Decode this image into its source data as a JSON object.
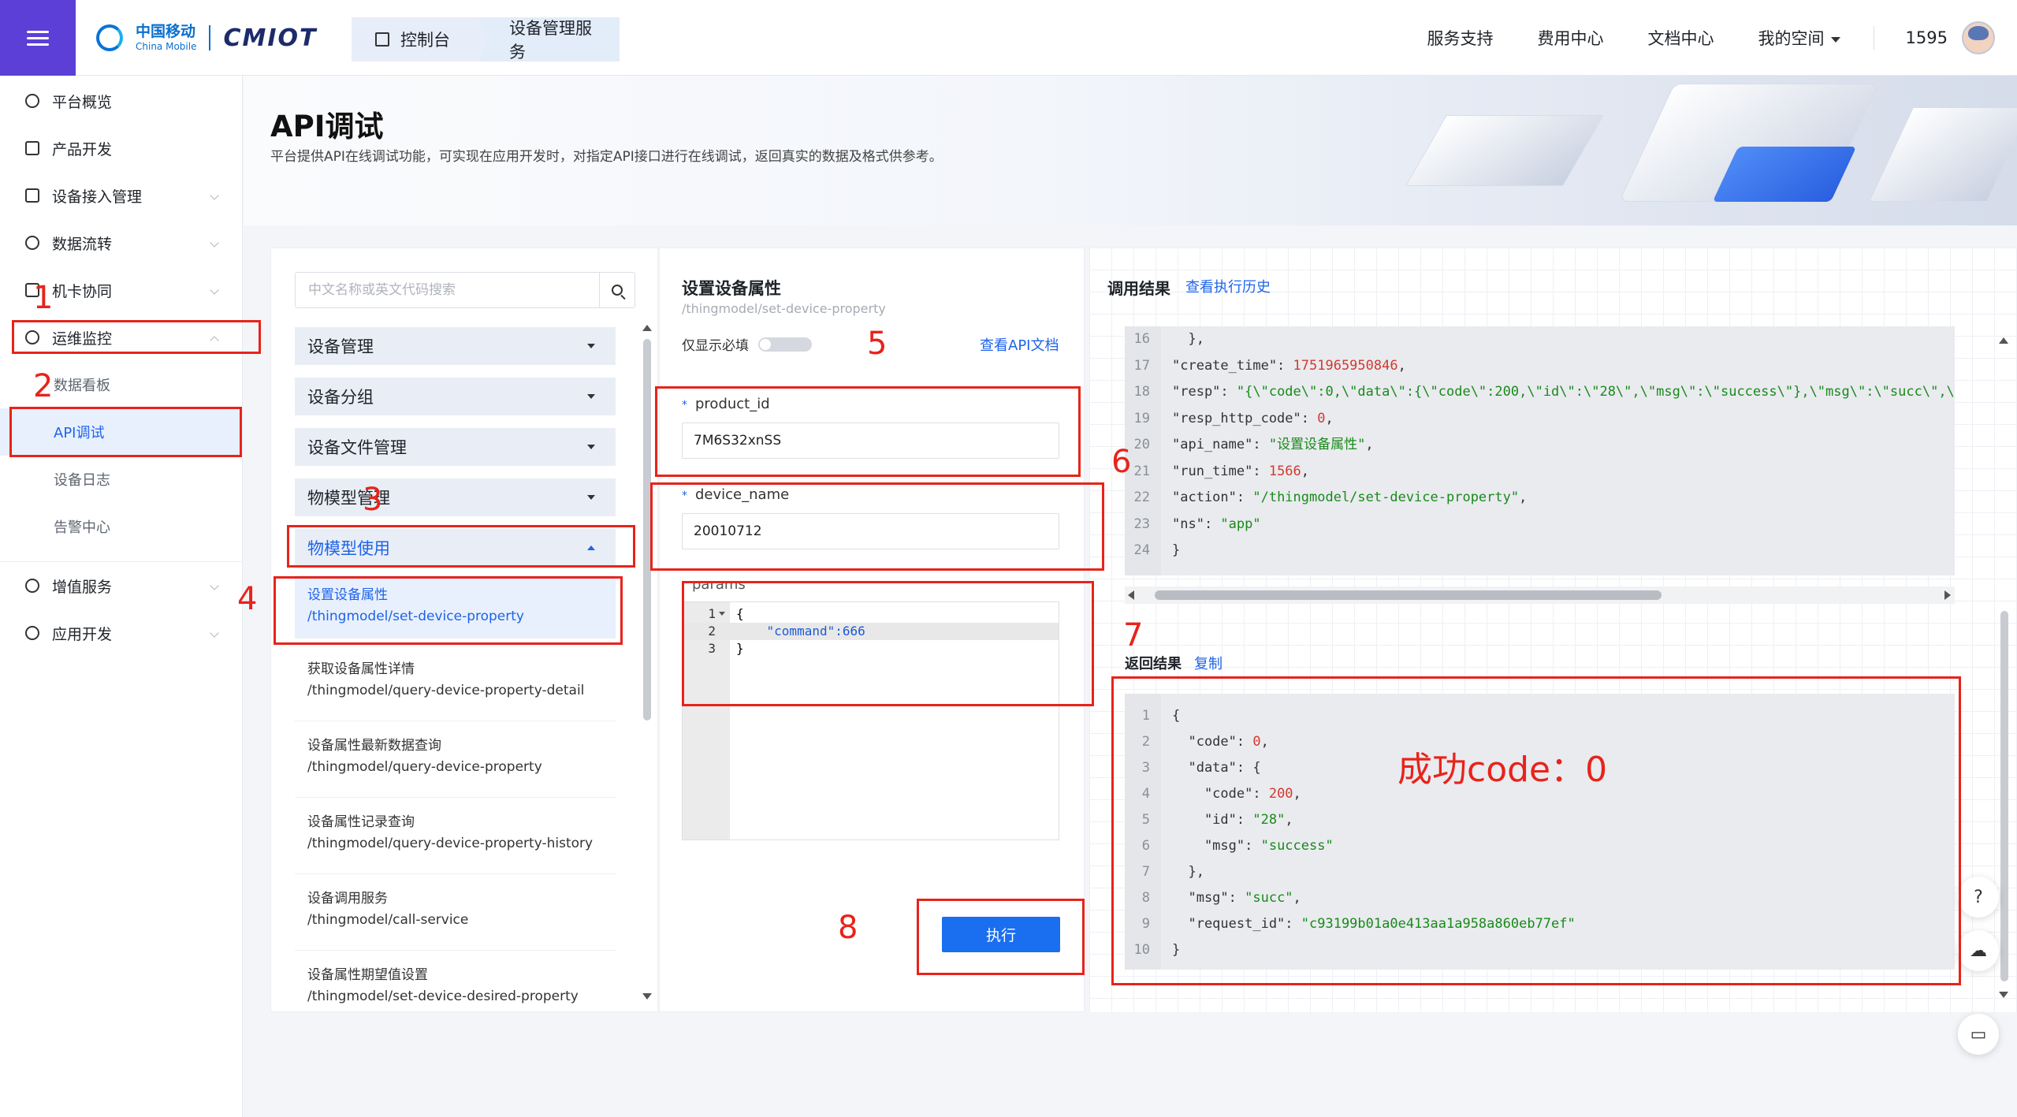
{
  "header": {
    "logo_cn": "中国移动",
    "logo_en": "China Mobile",
    "logo_brand": "CMIOT",
    "breadcrumb": [
      "控制台",
      "设备管理服务"
    ],
    "nav": [
      "服务支持",
      "费用中心",
      "文档中心",
      "我的空间"
    ],
    "user_id": "1595"
  },
  "sidebar": {
    "items": [
      {
        "label": "平台概览"
      },
      {
        "label": "产品开发"
      },
      {
        "label": "设备接入管理"
      },
      {
        "label": "数据流转"
      },
      {
        "label": "机卡协同"
      },
      {
        "label": "运维监控"
      },
      {
        "label": "增值服务"
      },
      {
        "label": "应用开发"
      }
    ],
    "sub_items": [
      "数据看板",
      "API调试",
      "设备日志",
      "告警中心"
    ]
  },
  "page": {
    "title": "API调试",
    "description": "平台提供API在线调试功能，可实现在应用开发时，对指定API接口进行在线调试，返回真实的数据及格式供参考。"
  },
  "left_panel": {
    "search_placeholder": "中文名称或英文代码搜索",
    "groups": [
      "设备管理",
      "设备分组",
      "设备文件管理",
      "物模型管理",
      "物模型使用"
    ],
    "apis": [
      {
        "name": "设置设备属性",
        "path": "/thingmodel/set-device-property"
      },
      {
        "name": "获取设备属性详情",
        "path": "/thingmodel/query-device-property-detail"
      },
      {
        "name": "设备属性最新数据查询",
        "path": "/thingmodel/query-device-property"
      },
      {
        "name": "设备属性记录查询",
        "path": "/thingmodel/query-device-property-history"
      },
      {
        "name": "设备调用服务",
        "path": "/thingmodel/call-service"
      },
      {
        "name": "设备属性期望值设置",
        "path": "/thingmodel/set-device-desired-property"
      }
    ]
  },
  "middle_panel": {
    "title": "设置设备属性",
    "path": "/thingmodel/set-device-property",
    "required_only_label": "仅显示必填",
    "required_only_on": false,
    "api_doc_link": "查看API文档",
    "fields": [
      {
        "label": "product_id",
        "value": "7M6S32xnSS"
      },
      {
        "label": "device_name",
        "value": "20010712"
      }
    ],
    "params_label": "params",
    "params_lines": [
      {
        "num": "1",
        "text": "{"
      },
      {
        "num": "2",
        "text": "    \"command\":666"
      },
      {
        "num": "3",
        "text": "}"
      }
    ],
    "run_button": "执行"
  },
  "right_panel": {
    "title": "调用结果",
    "history_link": "查看执行历史",
    "call_result_lines": [
      {
        "num": "16",
        "text": "  },"
      },
      {
        "num": "17",
        "key": "\"create_time\"",
        "value": "1751965950846",
        "vtype": "n",
        "tail": ","
      },
      {
        "num": "18",
        "key": "\"resp\"",
        "value": "\"{\\\"code\\\":0,\\\"data\\\":{\\\"code\\\":200,\\\"id\\\":\\\"28\\\",\\\"msg\\\":\\\"success\\\"},\\\"msg\\\":\\\"succ\\\",\\\"",
        "vtype": "s",
        "tail": ""
      },
      {
        "num": "19",
        "key": "\"resp_http_code\"",
        "value": "0",
        "vtype": "n",
        "tail": ","
      },
      {
        "num": "20",
        "key": "\"api_name\"",
        "value": "\"设置设备属性\"",
        "vtype": "s",
        "tail": ","
      },
      {
        "num": "21",
        "key": "\"run_time\"",
        "value": "1566",
        "vtype": "n",
        "tail": ","
      },
      {
        "num": "22",
        "key": "\"action\"",
        "value": "\"/thingmodel/set-device-property\"",
        "vtype": "s",
        "tail": ","
      },
      {
        "num": "23",
        "key": "\"ns\"",
        "value": "\"app\"",
        "vtype": "s",
        "tail": ""
      },
      {
        "num": "24",
        "text": "}"
      }
    ],
    "return_title": "返回结果",
    "copy_link": "复制",
    "return_lines": [
      {
        "num": "1",
        "text": "{"
      },
      {
        "num": "2",
        "key": "  \"code\"",
        "value": "0",
        "vtype": "n",
        "tail": ","
      },
      {
        "num": "3",
        "key": "  \"data\"",
        "value": "",
        "vtype": "k",
        "tail": "{"
      },
      {
        "num": "4",
        "key": "    \"code\"",
        "value": "200",
        "vtype": "n",
        "tail": ","
      },
      {
        "num": "5",
        "key": "    \"id\"",
        "value": "\"28\"",
        "vtype": "s",
        "tail": ","
      },
      {
        "num": "6",
        "key": "    \"msg\"",
        "value": "\"success\"",
        "vtype": "s",
        "tail": ""
      },
      {
        "num": "7",
        "text": "  },"
      },
      {
        "num": "8",
        "key": "  \"msg\"",
        "value": "\"succ\"",
        "vtype": "s",
        "tail": ","
      },
      {
        "num": "9",
        "key": "  \"request_id\"",
        "value": "\"c93199b01a0e413aa1a958a860eb77ef\"",
        "vtype": "s",
        "tail": ""
      },
      {
        "num": "10",
        "text": "}"
      }
    ]
  },
  "annotations": {
    "steps": [
      "1",
      "2",
      "3",
      "4",
      "5",
      "6",
      "7",
      "8"
    ],
    "success_note": "成功code：0",
    "color": "#e8231a"
  },
  "colors": {
    "brand_purple": "#5b3fd6",
    "primary_blue": "#1e63e9",
    "button_blue": "#1a6ef0"
  }
}
